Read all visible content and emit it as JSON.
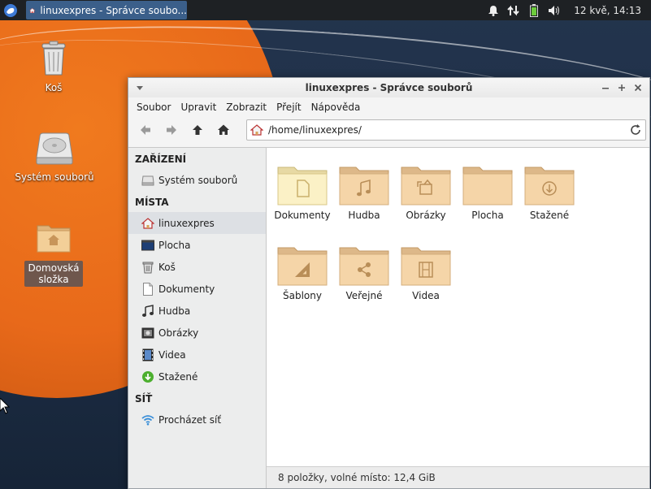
{
  "panel": {
    "task_title": "linuxexpres - Správce soubo...",
    "clock": "12 kvě, 14:13",
    "tray_icons": [
      "bell-icon",
      "network-icon",
      "battery-icon",
      "volume-icon"
    ]
  },
  "desktop": {
    "icons": [
      {
        "label": "Koš",
        "icon": "trash-icon"
      },
      {
        "label": "Systém souborů",
        "icon": "drive-icon"
      },
      {
        "label_line1": "Domovská",
        "label_line2": "složka",
        "icon": "home-folder-icon"
      }
    ]
  },
  "window": {
    "title": "linuxexpres - Správce souborů",
    "menu": [
      "Soubor",
      "Upravit",
      "Zobrazit",
      "Přejít",
      "Nápověda"
    ],
    "path": "/home/linuxexpres/",
    "sidebar": {
      "sections": [
        {
          "title": "ZAŘÍZENÍ",
          "items": [
            {
              "label": "Systém souborů",
              "icon": "drive-icon"
            }
          ]
        },
        {
          "title": "MÍSTA",
          "items": [
            {
              "label": "linuxexpres",
              "icon": "home-icon",
              "active": true
            },
            {
              "label": "Plocha",
              "icon": "desktop-icon"
            },
            {
              "label": "Koš",
              "icon": "trash-icon"
            },
            {
              "label": "Dokumenty",
              "icon": "document-icon"
            },
            {
              "label": "Hudba",
              "icon": "music-icon"
            },
            {
              "label": "Obrázky",
              "icon": "picture-icon"
            },
            {
              "label": "Videa",
              "icon": "video-icon"
            },
            {
              "label": "Stažené",
              "icon": "download-icon"
            }
          ]
        },
        {
          "title": "SÍŤ",
          "items": [
            {
              "label": "Procházet síť",
              "icon": "wifi-icon"
            }
          ]
        }
      ]
    },
    "files": [
      {
        "label": "Dokumenty",
        "emblem": "document"
      },
      {
        "label": "Hudba",
        "emblem": "music"
      },
      {
        "label": "Obrázky",
        "emblem": "picture"
      },
      {
        "label": "Plocha",
        "emblem": "none"
      },
      {
        "label": "Stažené",
        "emblem": "download"
      },
      {
        "label": "Šablony",
        "emblem": "template"
      },
      {
        "label": "Veřejné",
        "emblem": "share"
      },
      {
        "label": "Videa",
        "emblem": "video"
      }
    ],
    "status": "8 položky, volné místo: 12,4 GiB"
  }
}
